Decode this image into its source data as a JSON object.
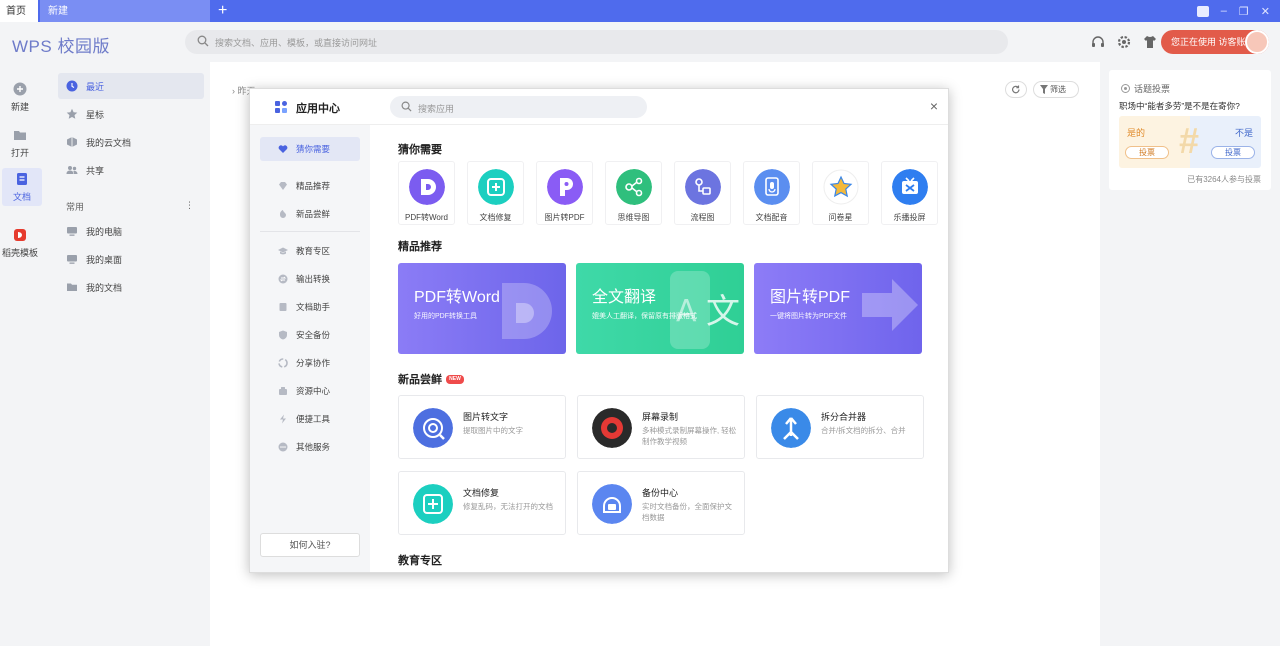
{
  "tabs": {
    "home": "首页",
    "new": "新建",
    "plus": "+"
  },
  "header": {
    "logo": "WPS 校园版",
    "search_placeholder": "搜索文档、应用、模板，或直接访问网址",
    "user_prefix": "您正在使用",
    "user_name": "访客账号"
  },
  "rail": [
    {
      "label": "新建",
      "icon": "plus-circle-icon"
    },
    {
      "label": "打开",
      "icon": "folder-icon"
    },
    {
      "label": "文档",
      "icon": "document-icon"
    },
    {
      "label": "稻壳模板",
      "icon": "docer-icon"
    }
  ],
  "sidebar": {
    "items": [
      {
        "label": "最近",
        "icon": "clock-icon"
      },
      {
        "label": "星标",
        "icon": "star-icon"
      },
      {
        "label": "我的云文档",
        "icon": "cloud-icon"
      },
      {
        "label": "共享",
        "icon": "users-icon"
      }
    ],
    "section": "常用",
    "section_more": "⋮",
    "pinned": [
      {
        "label": "我的电脑",
        "icon": "computer-icon"
      },
      {
        "label": "我的桌面",
        "icon": "desktop-icon"
      },
      {
        "label": "我的文档",
        "icon": "folder-icon"
      }
    ]
  },
  "main": {
    "crumb": "› 昨天",
    "filter": "筛选"
  },
  "vote": {
    "title": "话题投票",
    "question": "职场中“能者多劳”是不是在寄你?",
    "yes": "是的",
    "no": "不是",
    "btn": "投票",
    "count": "已有3264人参与投票"
  },
  "modal": {
    "title": "应用中心",
    "search_placeholder": "搜索应用",
    "close": "×",
    "side": [
      {
        "label": "猜你需要",
        "icon": "heart-icon"
      },
      {
        "label": "精品推荐",
        "icon": "diamond-icon"
      },
      {
        "label": "新品尝鲜",
        "icon": "hand-icon"
      },
      {
        "label": "教育专区",
        "icon": "graduation-icon"
      },
      {
        "label": "输出转换",
        "icon": "convert-icon"
      },
      {
        "label": "文档助手",
        "icon": "book-icon"
      },
      {
        "label": "安全备份",
        "icon": "shield-icon"
      },
      {
        "label": "分享协作",
        "icon": "share-icon"
      },
      {
        "label": "资源中心",
        "icon": "box-icon"
      },
      {
        "label": "便捷工具",
        "icon": "lightning-icon"
      },
      {
        "label": "其他服务",
        "icon": "more-icon"
      }
    ],
    "join": "如何入驻?",
    "sections": {
      "guess": "猜你需要",
      "featured": "精品推荐",
      "new": "新品尝鲜",
      "new_badge": "NEW",
      "edu": "教育专区"
    },
    "guess": [
      {
        "label": "PDF转Word",
        "color": "#7b5cf0"
      },
      {
        "label": "文档修复",
        "color": "#1ccfc0"
      },
      {
        "label": "图片转PDF",
        "color": "#8a5cf5"
      },
      {
        "label": "思维导图",
        "color": "#2fbf7d"
      },
      {
        "label": "流程图",
        "color": "#6c74e0"
      },
      {
        "label": "文档配音",
        "color": "#5b8ef0"
      },
      {
        "label": "问卷星",
        "color": "#ffffff"
      },
      {
        "label": "乐播投屏",
        "color": "#2f7ef0"
      }
    ],
    "banners": [
      {
        "title": "PDF转Word",
        "sub": "好用的PDF转换工具",
        "from": "#8b7cf6",
        "to": "#6d65ea"
      },
      {
        "title": "全文翻译",
        "sub": "媲美人工翻译，保留原有排版格式",
        "from": "#3fd9a8",
        "to": "#2fcf95"
      },
      {
        "title": "图片转PDF",
        "sub": "一键将图片转为PDF文件",
        "from": "#8d7cf7",
        "to": "#6f64ec"
      }
    ],
    "cards": [
      {
        "title": "图片转文字",
        "sub": "提取图片中的文字",
        "color": "#4d6fe0"
      },
      {
        "title": "屏幕录制",
        "sub": "多种模式录制屏幕操作, 轻松制作教学视频",
        "color": "#2a2a2a"
      },
      {
        "title": "拆分合并器",
        "sub": "合并/拆文档的拆分、合并",
        "color": "#3a8ae8"
      },
      {
        "title": "文档修复",
        "sub": "修复乱码，无法打开的文档",
        "color": "#1ccfc0"
      },
      {
        "title": "备份中心",
        "sub": "实时文档备份，全面保护文档数据",
        "color": "#5b86f0"
      }
    ]
  }
}
